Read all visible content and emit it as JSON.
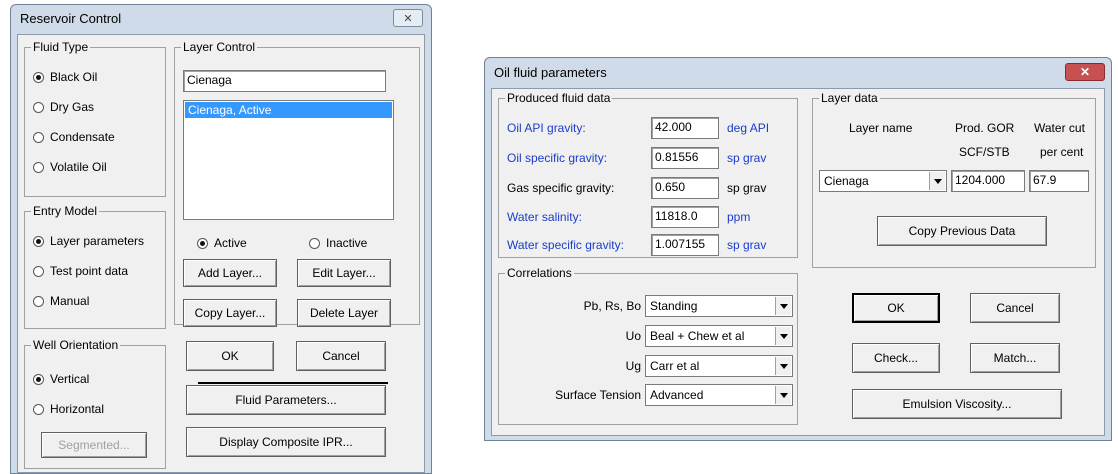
{
  "reservoir": {
    "title": "Reservoir Control",
    "close_glyph": "✕",
    "fluid_type": {
      "legend": "Fluid Type",
      "options": [
        "Black Oil",
        "Dry Gas",
        "Condensate",
        "Volatile Oil"
      ],
      "selected": "Black Oil"
    },
    "entry_model": {
      "legend": "Entry Model",
      "options": [
        "Layer parameters",
        "Test point data",
        "Manual"
      ],
      "selected": "Layer parameters"
    },
    "well_orientation": {
      "legend": "Well Orientation",
      "options": [
        "Vertical",
        "Horizontal"
      ],
      "selected": "Vertical",
      "segmented_label": "Segmented..."
    },
    "layer_control": {
      "legend": "Layer Control",
      "name_value": "Cienaga",
      "list_items": [
        "Cienaga, Active"
      ],
      "active_label": "Active",
      "inactive_label": "Inactive",
      "add_label": "Add Layer...",
      "edit_label": "Edit Layer...",
      "copy_label": "Copy Layer...",
      "delete_label": "Delete Layer"
    },
    "ok_label": "OK",
    "cancel_label": "Cancel",
    "fluid_params_label": "Fluid Parameters...",
    "display_ipr_label": "Display Composite IPR..."
  },
  "oil": {
    "title": "Oil fluid parameters",
    "close_glyph": "✕",
    "produced": {
      "legend": "Produced fluid data",
      "rows": [
        {
          "label": "Oil API gravity:",
          "value": "42.000",
          "unit": "deg API"
        },
        {
          "label": "Oil specific gravity:",
          "value": "0.81556",
          "unit": "sp grav"
        },
        {
          "label": "Gas specific gravity:",
          "value": "0.650",
          "unit": "sp grav"
        },
        {
          "label": "Water salinity:",
          "value": "11818.0",
          "unit": "ppm"
        },
        {
          "label": "Water specific gravity:",
          "value": "1.007155",
          "unit": "sp grav"
        }
      ]
    },
    "layer": {
      "legend": "Layer data",
      "col_name": "Layer name",
      "col_gor_1": "Prod. GOR",
      "col_gor_2": "SCF/STB",
      "col_wc_1": "Water cut",
      "col_wc_2": "per cent",
      "name_value": "Cienaga",
      "gor_value": "1204.000",
      "wc_value": "67.9",
      "copy_label": "Copy Previous Data"
    },
    "correlations": {
      "legend": "Correlations",
      "rows": [
        {
          "label": "Pb, Rs, Bo",
          "value": "Standing"
        },
        {
          "label": "Uo",
          "value": "Beal + Chew et al"
        },
        {
          "label": "Ug",
          "value": "Carr et al"
        },
        {
          "label": "Surface Tension",
          "value": "Advanced"
        }
      ]
    },
    "ok_label": "OK",
    "cancel_label": "Cancel",
    "check_label": "Check...",
    "match_label": "Match...",
    "emulsion_label": "Emulsion Viscosity..."
  },
  "colors": {
    "link_blue": "#1a3ccc",
    "selection": "#3399ff",
    "close_red": "#c75050"
  }
}
